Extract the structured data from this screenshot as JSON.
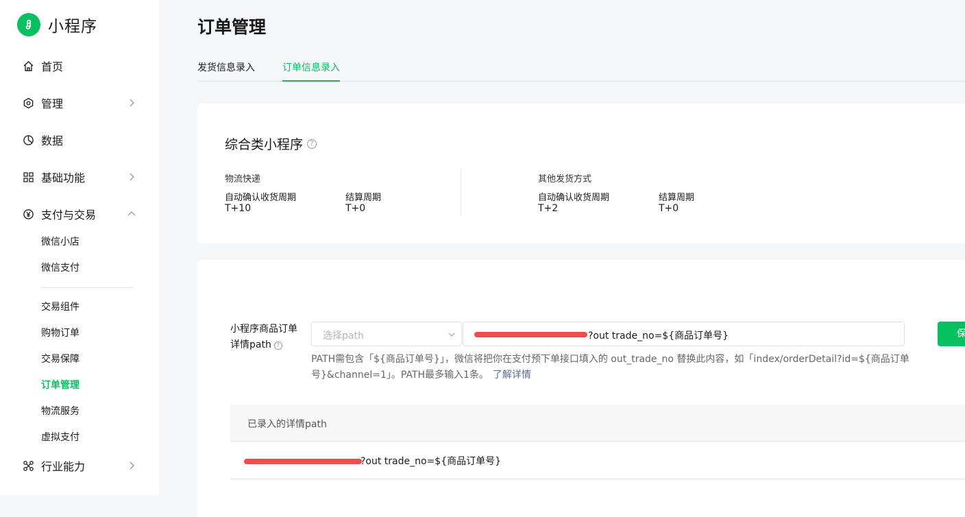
{
  "brand": {
    "name": "小程序",
    "color": "#07c160"
  },
  "nav": {
    "home": "首页",
    "manage": "管理",
    "data": "数据",
    "basic": "基础功能",
    "payment": "支付与交易",
    "industry": "行业能力"
  },
  "sub": {
    "wechat_shop": "微信小店",
    "wechat_pay": "微信支付",
    "trade_component": "交易组件",
    "shopping_order": "购物订单",
    "trade_guarantee": "交易保障",
    "order_manage": "订单管理",
    "logistics": "物流服务",
    "virtual_pay": "虚拟支付"
  },
  "page": {
    "title": "订单管理"
  },
  "tabs": [
    {
      "label": "发货信息录入",
      "active": false
    },
    {
      "label": "订单信息录入",
      "active": true
    }
  ],
  "summary": {
    "title": "综合类小程序",
    "help": "?",
    "sections": [
      {
        "title": "物流快递",
        "confirm_label": "自动确认收货周期",
        "confirm_value": "T+10",
        "settle_label": "结算周期",
        "settle_value": "T+0"
      },
      {
        "title": "其他发货方式",
        "confirm_label": "自动确认收货周期",
        "confirm_value": "T+2",
        "settle_label": "结算周期",
        "settle_value": "T+0"
      }
    ]
  },
  "form": {
    "label": "小程序商品订单详情path",
    "help": "?",
    "select_placeholder": "选择path",
    "path_value": "?out trade_no=${商品订单号}",
    "save_label": "保存",
    "hint": "PATH需包含「${商品订单号}」，微信将把你在支付预下单接口填入的 out_trade_no 替换此内容，如「index/orderDetail?id=${商品订单号}&channel=1」。PATH最多输入1条。",
    "hint_link": "了解详情"
  },
  "list": {
    "header": "已录入的详情path",
    "rows": [
      {
        "path": "?out trade_no=${商品订单号}"
      }
    ]
  }
}
